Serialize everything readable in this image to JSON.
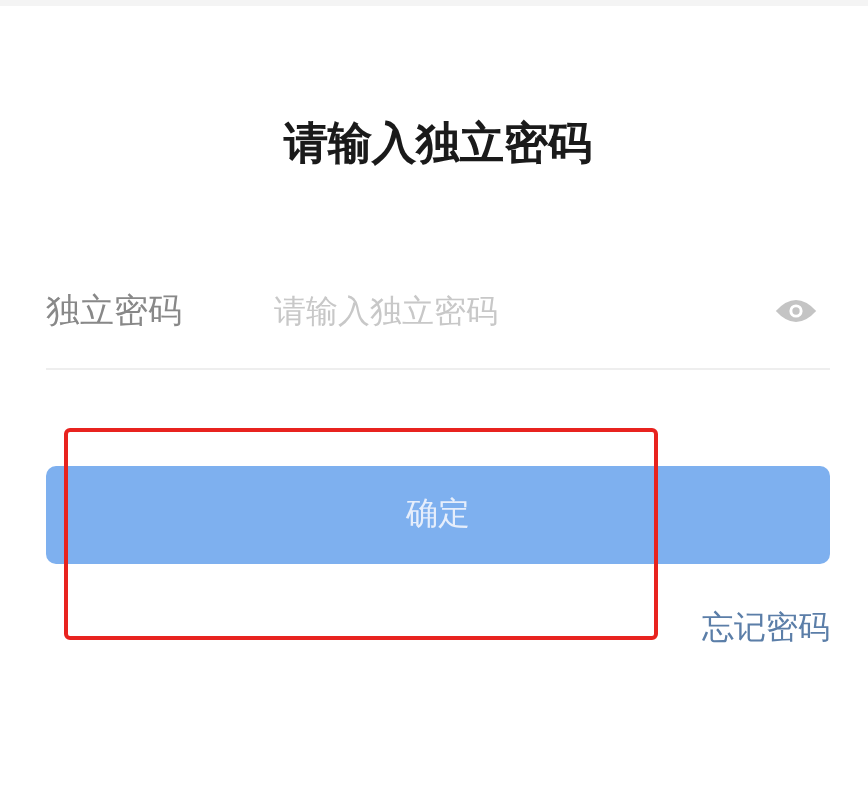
{
  "title": "请输入独立密码",
  "field": {
    "label": "独立密码",
    "placeholder": "请输入独立密码",
    "password_visible": false
  },
  "confirm_button": {
    "label": "确定",
    "disabled": true
  },
  "forgot_link": "忘记密码",
  "annotation": {
    "kind": "highlight"
  }
}
